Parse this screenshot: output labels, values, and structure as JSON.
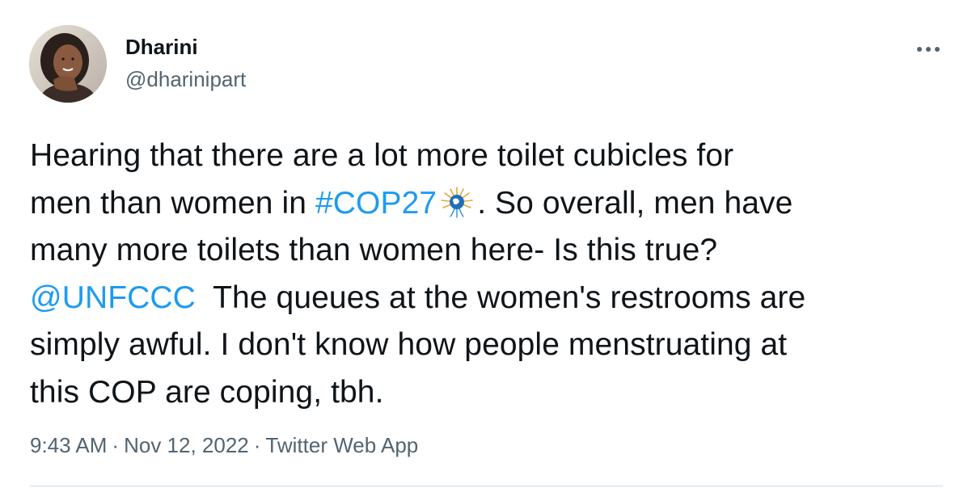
{
  "author": {
    "name": "Dharini",
    "handle": "@dharinipart"
  },
  "tweet": {
    "lines": [
      {
        "pre": "Hearing that there are a lot more toilet cubicles for"
      },
      {
        "pre": "men than women in ",
        "hashtag": "#COP27",
        "emoji": "cop27-hashflag-icon",
        "post": ". So overall, men have"
      },
      {
        "pre": "many more toilets than women here- Is this true?"
      },
      {
        "mention": "@UNFCCC",
        "post": "  The queues at the women's restrooms are"
      },
      {
        "pre": "simply awful. I don't know how people menstruating at"
      },
      {
        "pre": "this COP are coping, tbh."
      }
    ]
  },
  "meta": {
    "time": "9:43 AM",
    "date": "Nov 12, 2022",
    "separator": "·",
    "source": "Twitter Web App"
  },
  "colors": {
    "text": "#0f1419",
    "secondary": "#536471",
    "link": "#1d9bf0",
    "divider": "#cfd9de"
  },
  "icons": {
    "more": "more-options-icon",
    "avatar": "avatar"
  }
}
